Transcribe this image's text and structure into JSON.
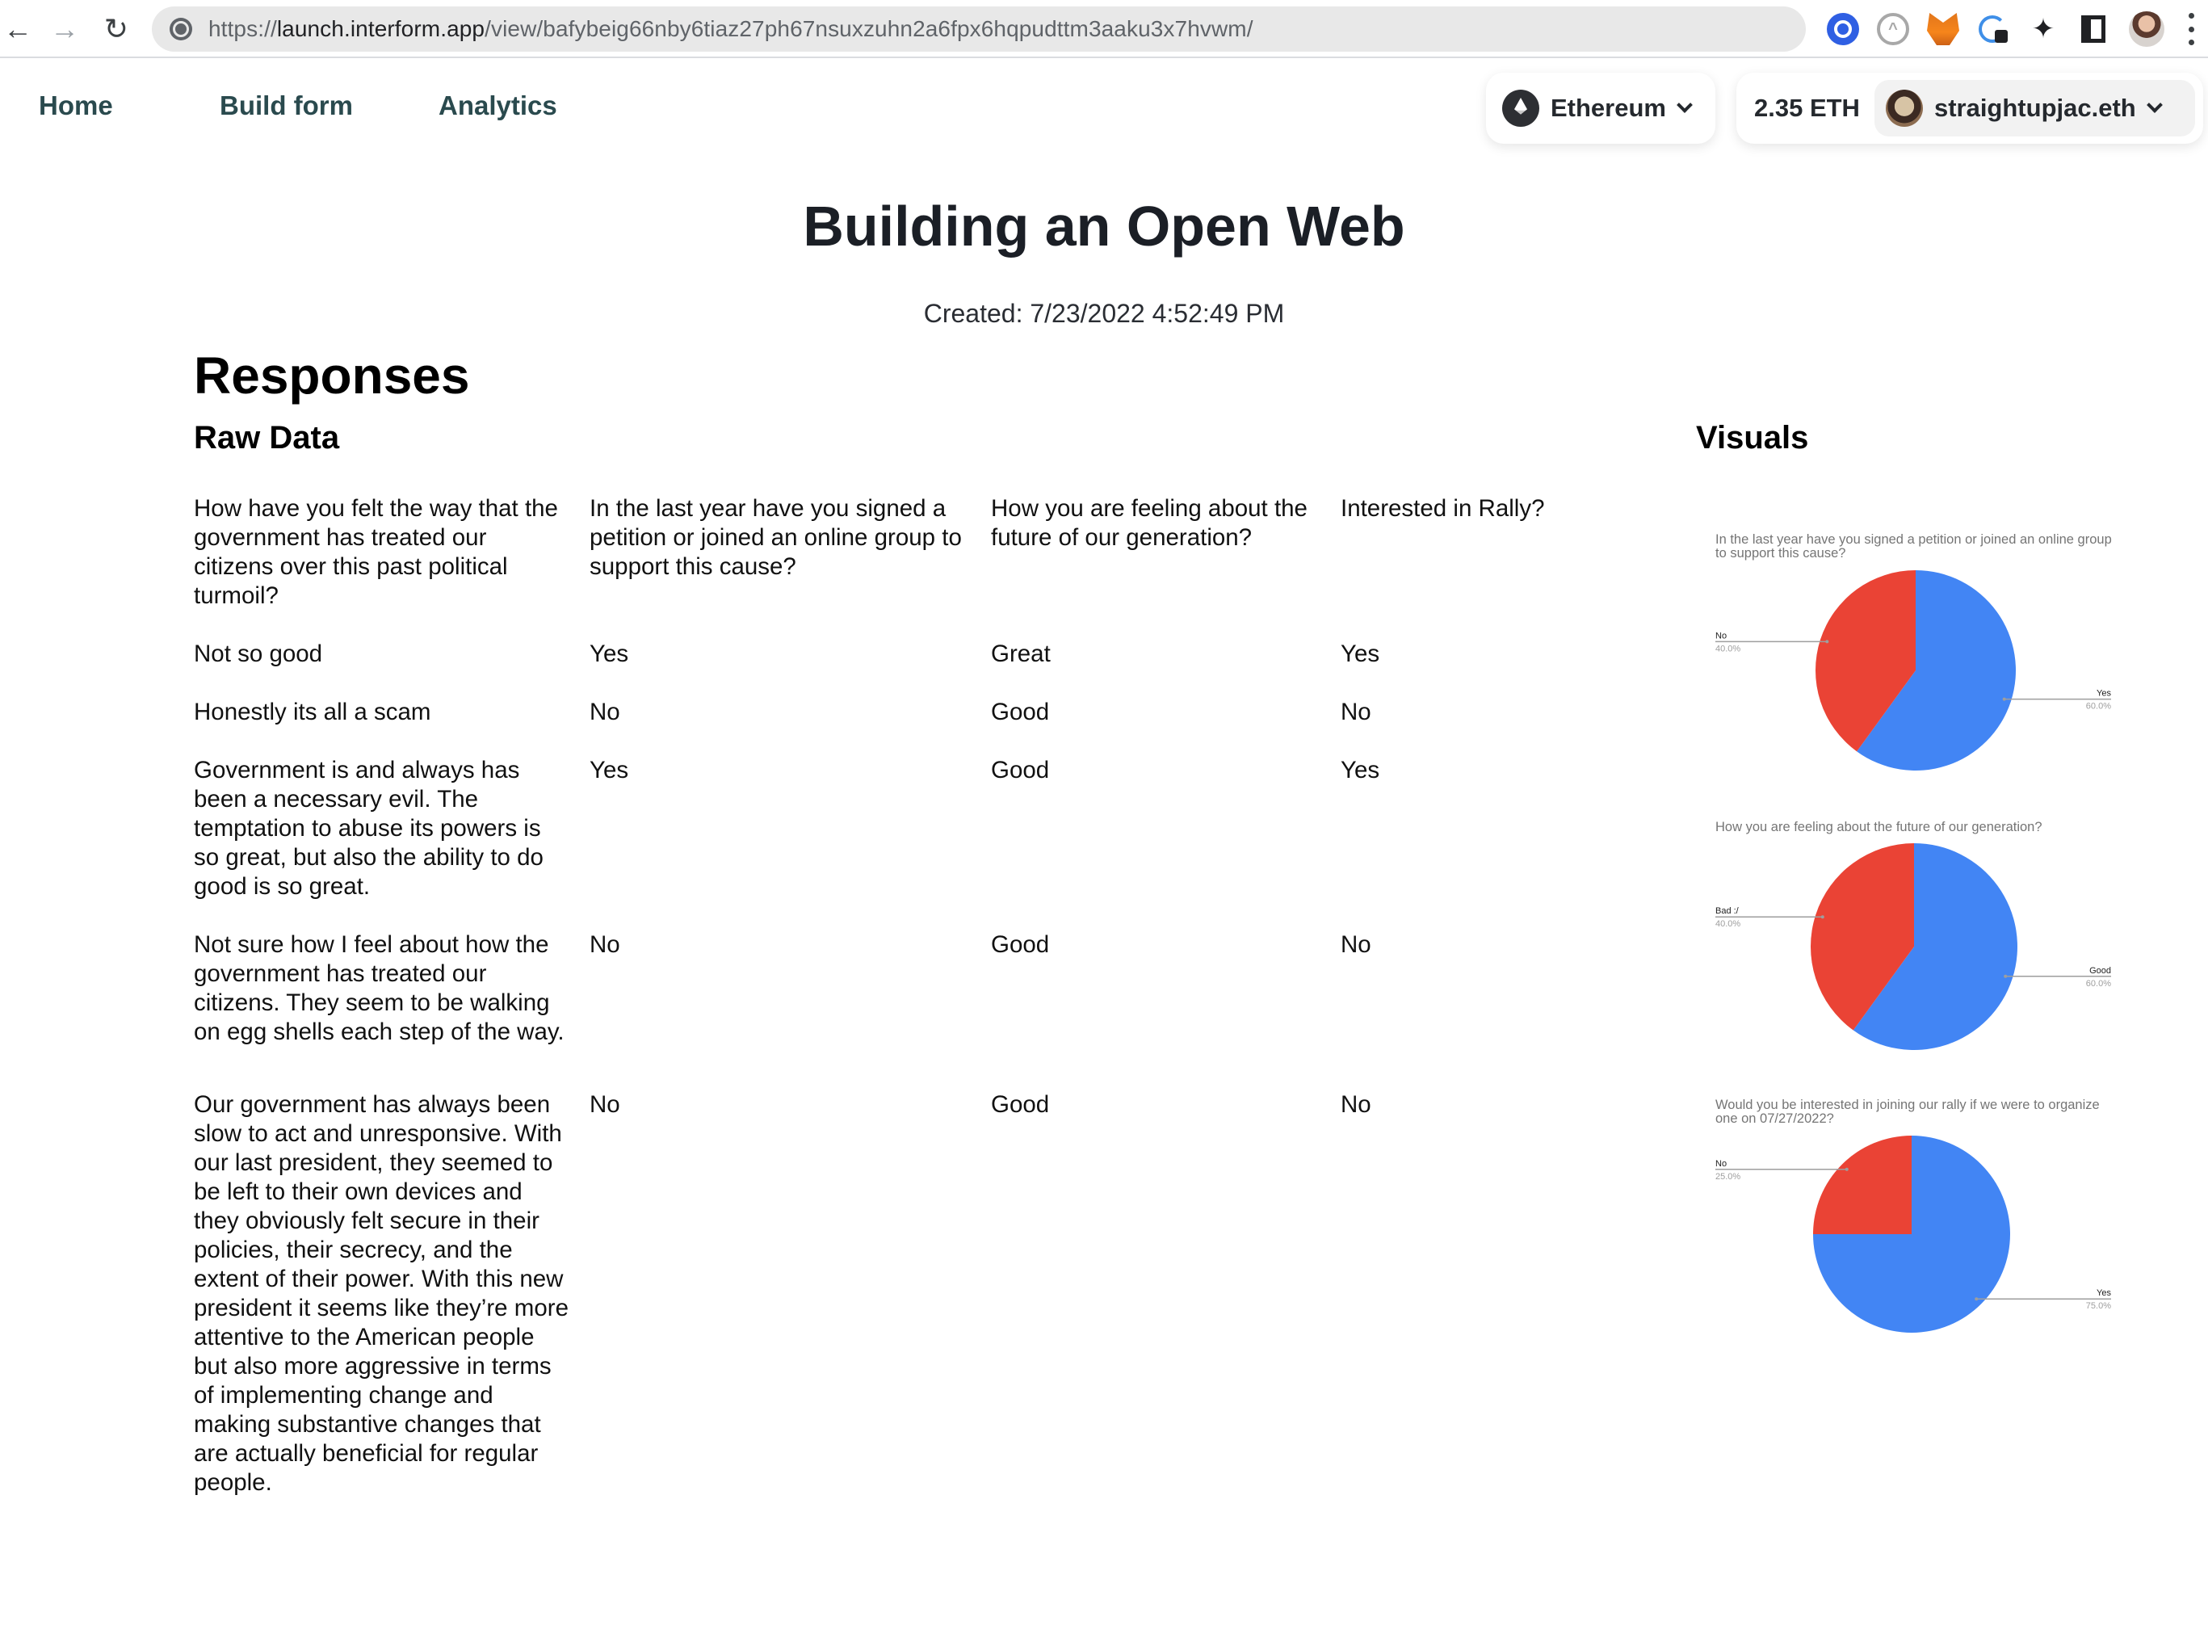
{
  "browser": {
    "url_prefix": "https://",
    "url_host": "launch.interform.app",
    "url_path": "/view/bafybeig66nby6tiaz27ph67nsuxzuhn2a6fpx6hqpudttm3aaku3x7hvwm/",
    "back_icon": "arrow-left-icon",
    "forward_icon": "arrow-right-icon",
    "reload_icon": "reload-icon",
    "extensions": [
      "1password-like-blue-icon",
      "gray-a-extension-icon",
      "metamask-fox-icon",
      "password-lock-icon",
      "puzzle-extensions-icon",
      "side-panel-icon"
    ],
    "profile_icon": "profile-avatar",
    "menu_icon": "kebab-menu-icon"
  },
  "nav": {
    "links": [
      {
        "label": "Home"
      },
      {
        "label": "Build form"
      },
      {
        "label": "Analytics"
      }
    ]
  },
  "wallet": {
    "chain": "Ethereum",
    "balance": "2.35 ETH",
    "account": "straightupjac.eth"
  },
  "page": {
    "title": "Building an Open Web",
    "created": "Created: 7/23/2022 4:52:49 PM",
    "responses_heading": "Responses",
    "raw_data_heading": "Raw Data",
    "visuals_heading": "Visuals"
  },
  "table": {
    "headers": [
      "How have you felt the way that the government has treated our citizens over this past political turmoil?",
      "In the last year have you signed a petition or joined an online group to support this cause?",
      "How you are feeling about the future of our generation?",
      "Interested in Rally?"
    ],
    "rows": [
      [
        "Not so good",
        "Yes",
        "Great",
        "Yes"
      ],
      [
        "Honestly its all a scam",
        "No",
        "Good",
        "No"
      ],
      [
        "Government is and always has been a necessary evil. The temptation to abuse its powers is so great, but also the ability to do good is so great.",
        "Yes",
        "Good",
        "Yes"
      ],
      [
        "Not sure how I feel about how the government has treated our citizens. They seem to be walking on egg shells each step of the way.",
        "No",
        "Good",
        "No"
      ],
      [
        "Our government has always been slow to act and unresponsive. With our last president, they seemed to be left to their own devices and they obviously felt secure in their policies, their secrecy, and the extent of their power. With this new president it seems like they’re more attentive to the American people but also more aggressive in terms of implementing change and making substantive changes that are actually beneficial for regular people.",
        "No",
        "Good",
        "No"
      ]
    ]
  },
  "colors": {
    "blue": "#4285f4",
    "red": "#ea4335",
    "nav_text": "#2a4a4e",
    "chart_title": "#757575",
    "label_pct": "#9e9e9e"
  },
  "chart_data": [
    {
      "type": "pie",
      "title": "In the last year have you signed a petition or joined an online group to support this cause?",
      "slices": [
        {
          "label": "Yes",
          "value": 60.0,
          "display": "60.0%",
          "color": "#4285f4"
        },
        {
          "label": "No",
          "value": 40.0,
          "display": "40.0%",
          "color": "#ea4335"
        }
      ],
      "legend": "labels-with-leader-lines"
    },
    {
      "type": "pie",
      "title": "How you are feeling about the future of our generation?",
      "slices": [
        {
          "label": "Good",
          "value": 60.0,
          "display": "60.0%",
          "color": "#4285f4"
        },
        {
          "label": "Bad :/",
          "value": 40.0,
          "display": "40.0%",
          "color": "#ea4335"
        }
      ],
      "legend": "labels-with-leader-lines"
    },
    {
      "type": "pie",
      "title": "Would you be interested in joining our rally if we were to organize one on 07/27/2022?",
      "slices": [
        {
          "label": "Yes",
          "value": 75.0,
          "display": "75.0%",
          "color": "#4285f4"
        },
        {
          "label": "No",
          "value": 25.0,
          "display": "25.0%",
          "color": "#ea4335"
        }
      ],
      "legend": "labels-with-leader-lines"
    }
  ]
}
